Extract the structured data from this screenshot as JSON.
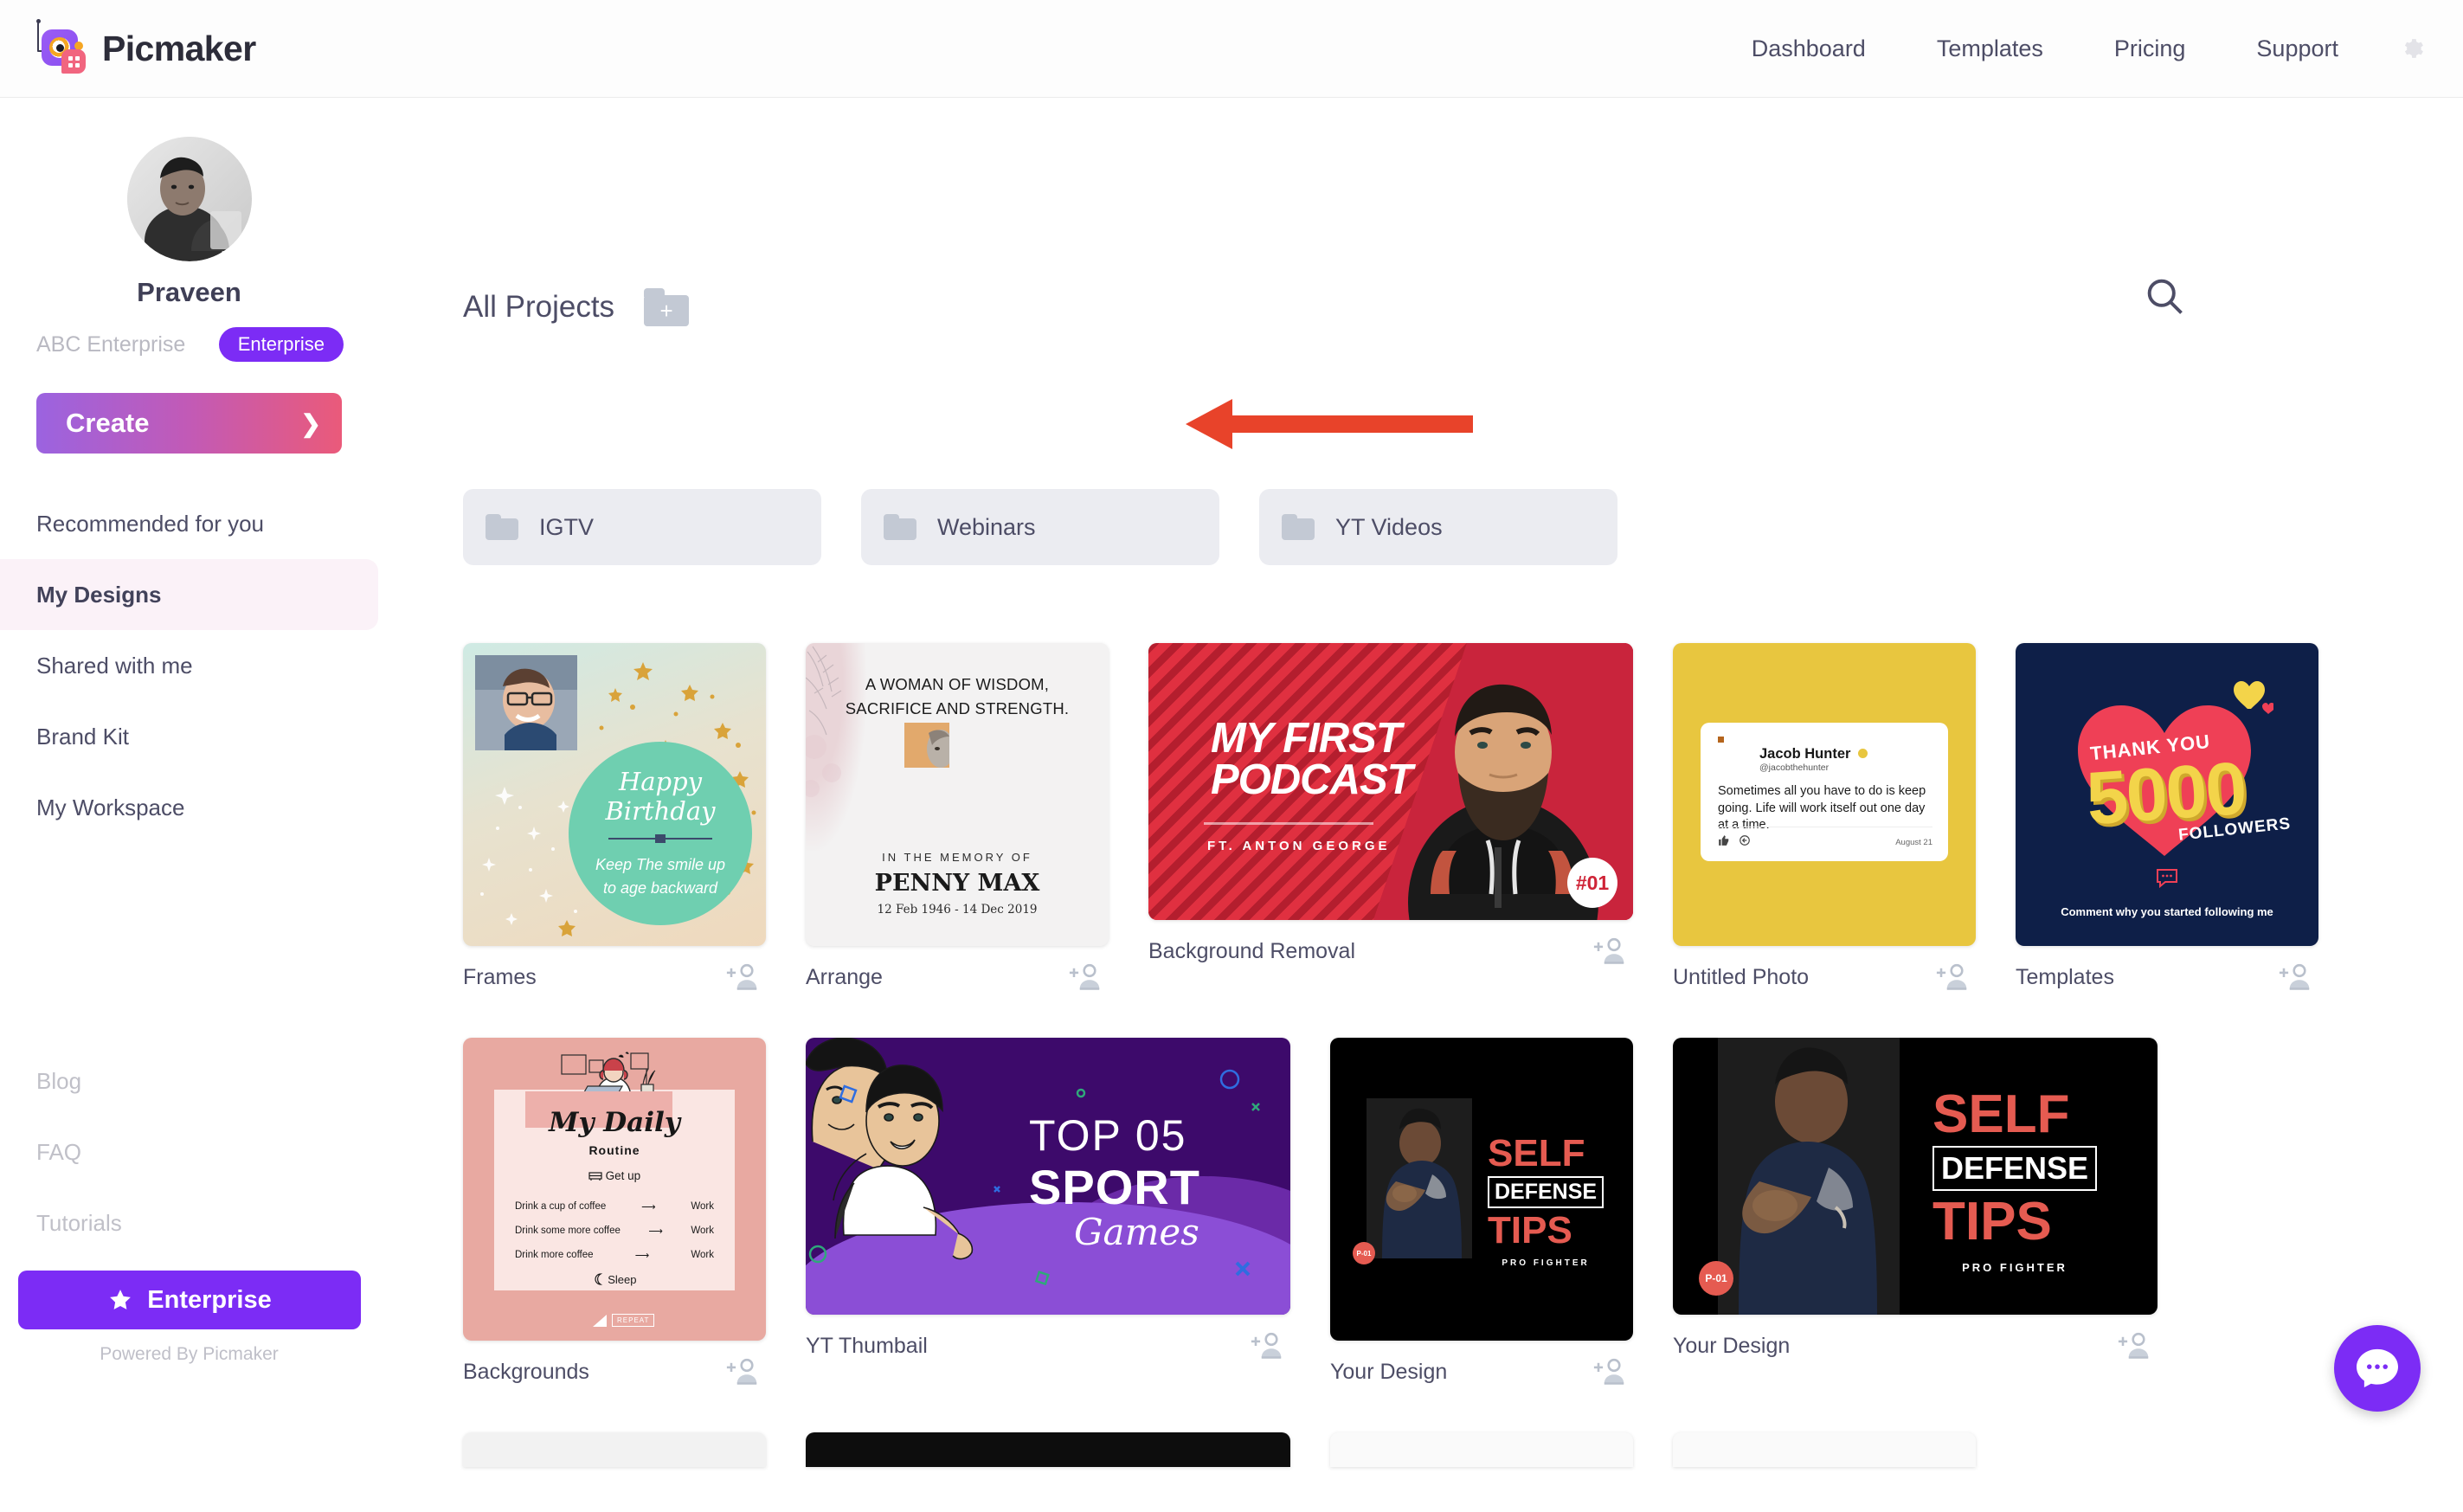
{
  "header": {
    "brand_name": "Picmaker",
    "logo_icon": "picmaker-camera-logo",
    "nav": [
      {
        "label": "Dashboard",
        "name": "nav-dashboard"
      },
      {
        "label": "Templates",
        "name": "nav-templates"
      },
      {
        "label": "Pricing",
        "name": "nav-pricing"
      },
      {
        "label": "Support",
        "name": "nav-support"
      }
    ],
    "settings_icon": "gear-icon"
  },
  "sidebar": {
    "avatar_icon": "user-avatar-photo",
    "profile_name": "Praveen",
    "org_name": "ABC Enterprise",
    "plan_badge": "Enterprise",
    "create_button": "Create",
    "create_chevron": "❯",
    "nav_items": [
      {
        "label": "Recommended for you",
        "name": "sidebar-item-recommended",
        "active": false
      },
      {
        "label": "My Designs",
        "name": "sidebar-item-my-designs",
        "active": true
      },
      {
        "label": "Shared with me",
        "name": "sidebar-item-shared-with-me",
        "active": false
      },
      {
        "label": "Brand Kit",
        "name": "sidebar-item-brand-kit",
        "active": false
      },
      {
        "label": "My Workspace",
        "name": "sidebar-item-my-workspace",
        "active": false
      }
    ],
    "footer_links": [
      {
        "label": "Blog",
        "name": "footer-link-blog"
      },
      {
        "label": "FAQ",
        "name": "footer-link-faq"
      },
      {
        "label": "Tutorials",
        "name": "footer-link-tutorials"
      }
    ],
    "enterprise_button": "Enterprise",
    "enterprise_icon": "star-icon",
    "powered_by": "Powered By Picmaker"
  },
  "main": {
    "projects_title": "All Projects",
    "new_folder_plus": "+",
    "new_folder_icon": "folder-plus-icon",
    "search_icon": "search-icon",
    "annotation_arrow": "red-left-arrow-annotation",
    "folders": [
      {
        "label": "IGTV",
        "name": "folder-chip-igtv"
      },
      {
        "label": "Webinars",
        "name": "folder-chip-webinars"
      },
      {
        "label": "YT Videos",
        "name": "folder-chip-yt-videos"
      }
    ],
    "share_icon": "add-person-icon",
    "designs_row1": [
      {
        "title": "Frames",
        "name": "design-card-frames"
      },
      {
        "title": "Arrange",
        "name": "design-card-arrange"
      },
      {
        "title": "Background Removal",
        "name": "design-card-background-removal"
      },
      {
        "title": "Untitled Photo",
        "name": "design-card-untitled-photo"
      },
      {
        "title": "Templates",
        "name": "design-card-templates"
      }
    ],
    "designs_row2": [
      {
        "title": "Backgrounds",
        "name": "design-card-backgrounds"
      },
      {
        "title": "YT Thumbail",
        "name": "design-card-yt-thumbail"
      },
      {
        "title": "Your Design",
        "name": "design-card-your-design-1"
      },
      {
        "title": "Your Design",
        "name": "design-card-your-design-2"
      }
    ],
    "artwork": {
      "birthday": {
        "greeting": "Happy Birthday",
        "line1": "Keep The smile up",
        "line2": "to age backward"
      },
      "memorial": {
        "headline": "A WOMAN OF WISDOM,\nSACRIFICE AND STRENGTH.",
        "kicker": "IN THE MEMORY OF",
        "name": "PENNY MAX",
        "dates": "12 Feb 1946 - 14 Dec 2019"
      },
      "podcast": {
        "line1": "MY FIRST",
        "line2": "PODCAST",
        "featuring": "FT. ANTON GEORGE",
        "episode": "#01"
      },
      "tweet": {
        "author": "Jacob Hunter",
        "handle": "@jacobthehunter",
        "body": "Sometimes all you have to do is keep going. Life will work itself out one day at a time.",
        "date": "August 21",
        "verified_icon": "verified-badge-icon",
        "like_icon": "thumbs-up-icon",
        "reply_icon": "reply-icon"
      },
      "followers": {
        "thanks": "THANK YOU",
        "count": "5000",
        "unit": "FOLLOWERS",
        "caption": "Comment why you started following me",
        "comment_icon": "comment-bubble-icon"
      },
      "routine": {
        "title": "My Daily",
        "subtitle": "Routine",
        "first": "Get up",
        "last": "Sleep",
        "steps": [
          {
            "task": "Drink a cup of coffee",
            "then": "Work"
          },
          {
            "task": "Drink some more coffee",
            "then": "Work"
          },
          {
            "task": "Drink more coffee",
            "then": "Work"
          }
        ],
        "repeat": "REPEAT",
        "bed_icon": "bed-icon",
        "sleep_icon": "moon-icon"
      },
      "sport": {
        "top": "TOP 05",
        "sport": "SPORT",
        "games": "Games"
      },
      "selfdefense": {
        "line1": "SELF",
        "line2": "DEFENSE",
        "line3": "TIPS",
        "tag": "PRO FIGHTER",
        "badge": "P-01"
      }
    },
    "chat_widget_icon": "chat-bubble-icon"
  },
  "colors": {
    "brand_purple": "#7c2cf5",
    "create_gradient_from": "#9b63e0",
    "create_gradient_to": "#ea5a7a",
    "active_nav_bg": "#fbf2f8",
    "text_primary": "#4d4d66",
    "text_muted": "#c0c0c8",
    "annotation_red": "#e8432a",
    "folder_chip_bg": "#ebecf1"
  }
}
